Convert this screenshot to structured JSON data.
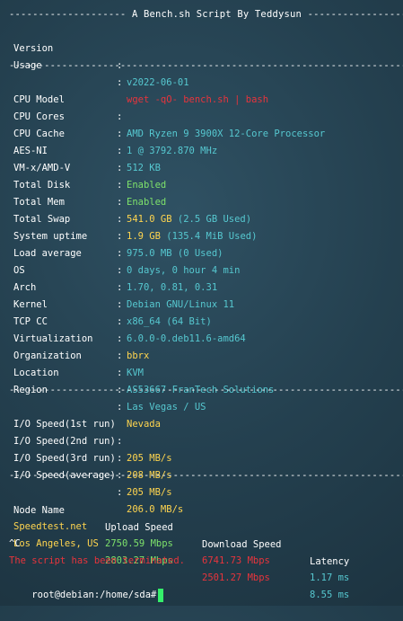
{
  "header": {
    "banner": "-------------------- A Bench.sh Script By Teddysun -------------------"
  },
  "separator": "----------------------------------------------------------------------",
  "meta": [
    {
      "key": "Version",
      "value": "v2022-06-01",
      "color": "cyan"
    },
    {
      "key": "Usage",
      "value": "wget -qO- bench.sh | bash",
      "color": "red"
    }
  ],
  "system": [
    {
      "key": "CPU Model",
      "value": "AMD Ryzen 9 3900X 12-Core Processor",
      "color": "cyan"
    },
    {
      "key": "CPU Cores",
      "value": "1 @ 3792.870 MHz",
      "color": "cyan"
    },
    {
      "key": "CPU Cache",
      "value": "512 KB",
      "color": "cyan"
    },
    {
      "key": "AES-NI",
      "value": "Enabled",
      "color": "green"
    },
    {
      "key": "VM-x/AMD-V",
      "value": "Enabled",
      "color": "green"
    },
    {
      "key": "Total Disk",
      "value": "541.0 GB",
      "extra": " (2.5 GB Used)",
      "color": "yellow"
    },
    {
      "key": "Total Mem",
      "value": "1.9 GB",
      "extra": " (135.4 MiB Used)",
      "color": "yellow"
    },
    {
      "key": "Total Swap",
      "value": "975.0 MB (0 Used)",
      "color": "cyan"
    },
    {
      "key": "System uptime",
      "value": "0 days, 0 hour 4 min",
      "color": "cyan"
    },
    {
      "key": "Load average",
      "value": "1.70, 0.81, 0.31",
      "color": "cyan"
    },
    {
      "key": "OS",
      "value": "Debian GNU/Linux 11",
      "color": "cyan"
    },
    {
      "key": "Arch",
      "value": "x86_64 (64 Bit)",
      "color": "cyan"
    },
    {
      "key": "Kernel",
      "value": "6.0.0-0.deb11.6-amd64",
      "color": "cyan"
    },
    {
      "key": "TCP CC",
      "value": "bbrx",
      "color": "yellow"
    },
    {
      "key": "Virtualization",
      "value": "KVM",
      "color": "cyan"
    },
    {
      "key": "Organization",
      "value": "AS53667 FranTech Solutions",
      "color": "cyan"
    },
    {
      "key": "Location",
      "value": "Las Vegas / US",
      "color": "cyan"
    },
    {
      "key": "Region",
      "value": "Nevada",
      "color": "yellow"
    }
  ],
  "io": [
    {
      "key": "I/O Speed(1st run)",
      "value": "205 MB/s"
    },
    {
      "key": "I/O Speed(2nd run)",
      "value": "208 MB/s"
    },
    {
      "key": "I/O Speed(3rd run)",
      "value": "205 MB/s"
    },
    {
      "key": "I/O Speed(average)",
      "value": "206.0 MB/s"
    }
  ],
  "speedtest": {
    "headers": [
      "Node Name",
      "Upload Speed",
      "Download Speed",
      "Latency"
    ],
    "rows": [
      {
        "node": "Speedtest.net",
        "upload": "2750.59 Mbps",
        "download": "6741.73 Mbps",
        "latency": "1.17 ms"
      },
      {
        "node": "Los Angeles, US",
        "upload": "2803.27 Mbps",
        "download": "2501.27 Mbps",
        "latency": "8.55 ms"
      }
    ]
  },
  "footer": {
    "interrupt": "^C",
    "terminated": "The script has been terminated.",
    "prompt": "root@debian:/home/sda#"
  },
  "colors": {
    "background": "#24404f",
    "cyan": "#56c8d0",
    "green": "#7ee26b",
    "yellow": "#ffd54f",
    "red": "#e8343c",
    "cursor": "#35f06b"
  }
}
